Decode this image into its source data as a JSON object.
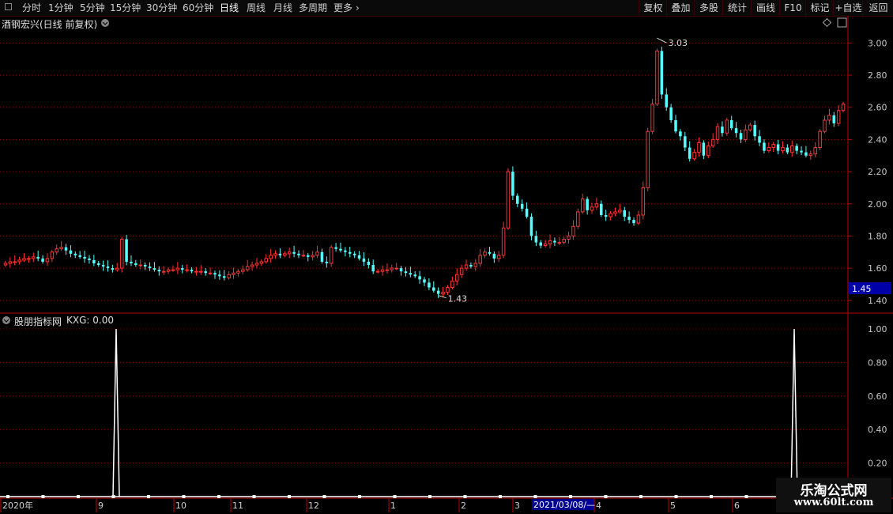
{
  "toolbar": {
    "left": [
      {
        "label": "分时",
        "active": false
      },
      {
        "label": "1分钟",
        "active": false
      },
      {
        "label": "5分钟",
        "active": false
      },
      {
        "label": "15分钟",
        "active": false
      },
      {
        "label": "30分钟",
        "active": false
      },
      {
        "label": "60分钟",
        "active": false
      },
      {
        "label": "日线",
        "active": true
      },
      {
        "label": "周线",
        "active": false
      },
      {
        "label": "月线",
        "active": false
      },
      {
        "label": "多周期",
        "active": false
      },
      {
        "label": "更多",
        "active": false
      }
    ],
    "more_chevron": "›",
    "right": [
      "复权",
      "叠加",
      "多股",
      "统计",
      "画线",
      "F10",
      "标记",
      "+自选",
      "返回"
    ]
  },
  "main_panel": {
    "title": "酒钢宏兴(日线 前复权)",
    "y_labels": [
      "3.00",
      "2.80",
      "2.60",
      "2.40",
      "2.20",
      "2.00",
      "1.80",
      "1.60",
      "1.40"
    ],
    "current_price": "1.45",
    "high_label": "3.03",
    "low_label": "1.43",
    "colors": {
      "up": "#ff3232",
      "down": "#54ffff",
      "grid": "#8b0000",
      "axis": "#c00000",
      "price_tag": "#0000a8"
    }
  },
  "indicator_panel": {
    "title": "股朋指标网",
    "kxg_label": "KXG: 0.00",
    "y_labels": [
      "1.00",
      "0.80",
      "0.60",
      "0.40",
      "0.20"
    ]
  },
  "x_axis": {
    "labels": [
      "2020年",
      "9",
      "10",
      "11",
      "12",
      "1",
      "2",
      "3",
      "4",
      "5",
      "6"
    ],
    "cursor_date": "2021/03/08/—"
  },
  "watermark": {
    "line1": "乐淘公式网",
    "line2": "www.60lt.com"
  },
  "chart_data": {
    "type": "candlestick",
    "title": "酒钢宏兴(日线 前复权)",
    "ylim": [
      1.34,
      3.1
    ],
    "annotations": {
      "high": 3.03,
      "low": 1.43,
      "last": 1.45
    },
    "close_series": [
      1.63,
      1.64,
      1.64,
      1.65,
      1.66,
      1.66,
      1.67,
      1.66,
      1.64,
      1.66,
      1.7,
      1.72,
      1.73,
      1.71,
      1.69,
      1.68,
      1.67,
      1.66,
      1.65,
      1.63,
      1.62,
      1.61,
      1.6,
      1.59,
      1.6,
      1.78,
      1.64,
      1.63,
      1.62,
      1.62,
      1.61,
      1.6,
      1.59,
      1.58,
      1.58,
      1.59,
      1.59,
      1.6,
      1.59,
      1.59,
      1.58,
      1.58,
      1.58,
      1.57,
      1.57,
      1.56,
      1.55,
      1.54,
      1.56,
      1.57,
      1.58,
      1.59,
      1.61,
      1.62,
      1.63,
      1.64,
      1.66,
      1.68,
      1.69,
      1.68,
      1.69,
      1.7,
      1.69,
      1.68,
      1.68,
      1.67,
      1.68,
      1.7,
      1.64,
      1.63,
      1.73,
      1.72,
      1.71,
      1.7,
      1.69,
      1.68,
      1.66,
      1.64,
      1.62,
      1.58,
      1.58,
      1.59,
      1.59,
      1.6,
      1.6,
      1.58,
      1.57,
      1.56,
      1.55,
      1.53,
      1.51,
      1.48,
      1.46,
      1.44,
      1.45,
      1.48,
      1.52,
      1.56,
      1.6,
      1.62,
      1.61,
      1.63,
      1.68,
      1.7,
      1.69,
      1.66,
      1.68,
      1.85,
      2.2,
      2.05,
      2.0,
      1.97,
      1.92,
      1.8,
      1.76,
      1.74,
      1.75,
      1.77,
      1.76,
      1.76,
      1.78,
      1.8,
      1.86,
      1.95,
      2.03,
      1.96,
      1.98,
      2.0,
      1.93,
      1.92,
      1.94,
      1.95,
      1.96,
      1.92,
      1.9,
      1.88,
      1.93,
      2.1,
      2.45,
      2.62,
      2.95,
      2.68,
      2.6,
      2.52,
      2.45,
      2.42,
      2.35,
      2.28,
      2.32,
      2.38,
      2.3,
      2.36,
      2.4,
      2.48,
      2.44,
      2.52,
      2.47,
      2.44,
      2.4,
      2.46,
      2.49,
      2.42,
      2.38,
      2.33,
      2.35,
      2.37,
      2.33,
      2.35,
      2.32,
      2.36,
      2.33,
      2.32,
      2.3,
      2.31,
      2.35,
      2.45,
      2.52,
      2.55,
      2.5,
      2.58,
      2.62
    ],
    "kxg": {
      "ylim": [
        0,
        1
      ],
      "signal_index": [
        25,
        178
      ],
      "signal_value": 1.0
    }
  }
}
